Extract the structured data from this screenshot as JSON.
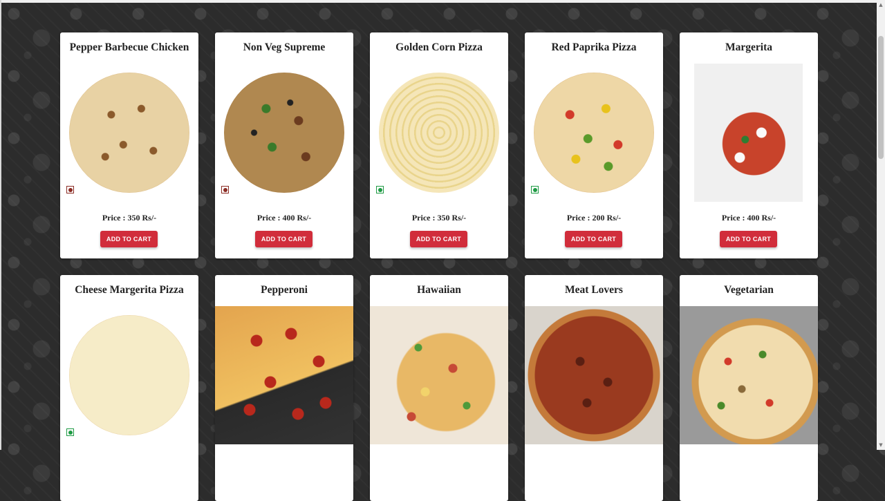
{
  "currency_suffix": "Rs/-",
  "price_prefix": "Price : ",
  "add_to_cart_label": "ADD TO CART",
  "colors": {
    "accent": "#d12d3b",
    "veg": "#1e9a44",
    "nonveg": "#8b2c24"
  },
  "products": [
    {
      "name": "Pepper Barbecue Chicken",
      "price_text": "Price : 350 Rs/-",
      "veg": false
    },
    {
      "name": "Non Veg Supreme",
      "price_text": "Price : 400 Rs/-",
      "veg": false
    },
    {
      "name": "Golden Corn Pizza",
      "price_text": "Price : 350 Rs/-",
      "veg": true
    },
    {
      "name": "Red Paprika Pizza",
      "price_text": "Price : 200 Rs/-",
      "veg": true
    },
    {
      "name": "Margerita",
      "price_text": "Price : 400 Rs/-"
    },
    {
      "name": "Cheese Margerita Pizza",
      "veg": true
    },
    {
      "name": "Pepperoni"
    },
    {
      "name": "Hawaiian"
    },
    {
      "name": "Meat Lovers"
    },
    {
      "name": "Vegetarian"
    }
  ]
}
